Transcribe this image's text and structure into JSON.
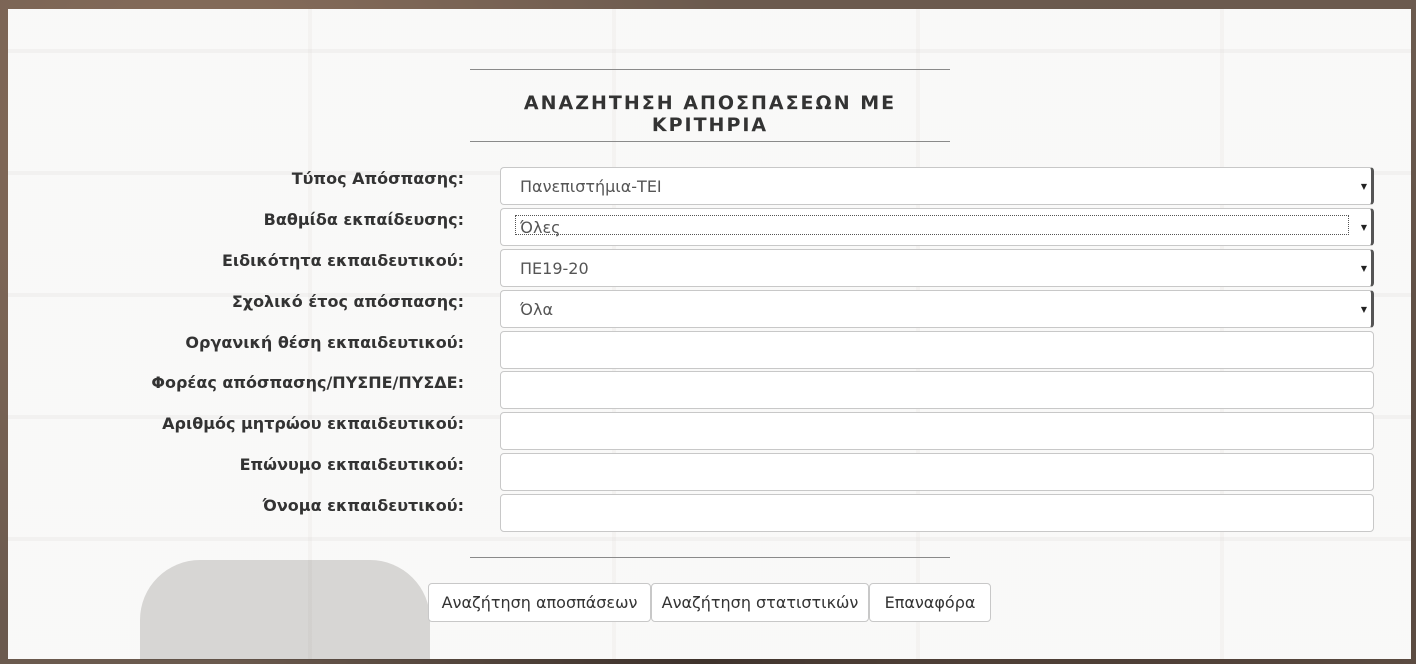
{
  "form": {
    "title": "ΑΝΑΖΗΤΗΣΗ ΑΠΟΣΠΑΣΕΩΝ ΜΕ ΚΡΙΤΗΡΙΑ",
    "fields": [
      {
        "label": "Τύπος Απόσπασης:",
        "type": "select",
        "value": "Πανεπιστήμια-ΤΕΙ"
      },
      {
        "label": "Βαθμίδα εκπαίδευσης:",
        "type": "select",
        "value": "Όλες"
      },
      {
        "label": "Ειδικότητα εκπαιδευτικού:",
        "type": "select",
        "value": "ΠΕ19-20"
      },
      {
        "label": "Σχολικό έτος απόσπασης:",
        "type": "select",
        "value": "Όλα"
      },
      {
        "label": "Οργανική θέση εκπαιδευτικού:",
        "type": "text",
        "value": ""
      },
      {
        "label": "Φορέας απόσπασης/ΠΥΣΠΕ/ΠΥΣΔΕ:",
        "type": "text",
        "value": ""
      },
      {
        "label": "Αριθμός μητρώου εκπαιδευτικού:",
        "type": "text",
        "value": ""
      },
      {
        "label": "Επώνυμο εκπαιδευτικού:",
        "type": "text",
        "value": ""
      },
      {
        "label": "Όνομα εκπαιδευτικού:",
        "type": "text",
        "value": ""
      }
    ],
    "buttons": {
      "search": "Αναζήτηση αποσπάσεων",
      "stats": "Αναζήτηση στατιστικών",
      "reset": "Επαναφόρα"
    }
  },
  "icons": {
    "select_arrow": "triangle-down-icon"
  }
}
